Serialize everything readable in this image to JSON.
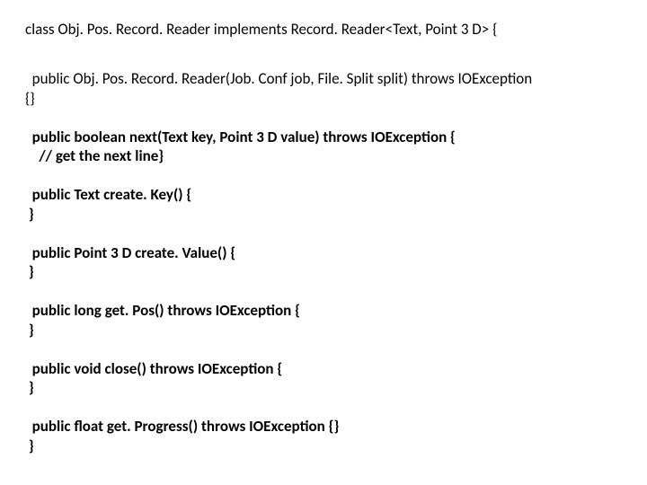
{
  "code": {
    "l1": "class Obj. Pos. Record. Reader implements Record. Reader<Text, Point 3 D> {",
    "l2": "  public Obj. Pos. Record. Reader(Job. Conf job, File. Split split) throws IOException",
    "l3": "{}",
    "l4": "  public boolean next(Text key, Point 3 D value) throws IOException {",
    "l5": "    // get the next line}",
    "l6": "  public Text create. Key() {",
    "l7": " }",
    "l8": "  public Point 3 D create. Value() {",
    "l9": " }",
    "l10": "  public long get. Pos() throws IOException {",
    "l11": " }",
    "l12": "  public void close() throws IOException {",
    "l13": " }",
    "l14": "  public float get. Progress() throws IOException {}",
    "l15": " }"
  }
}
